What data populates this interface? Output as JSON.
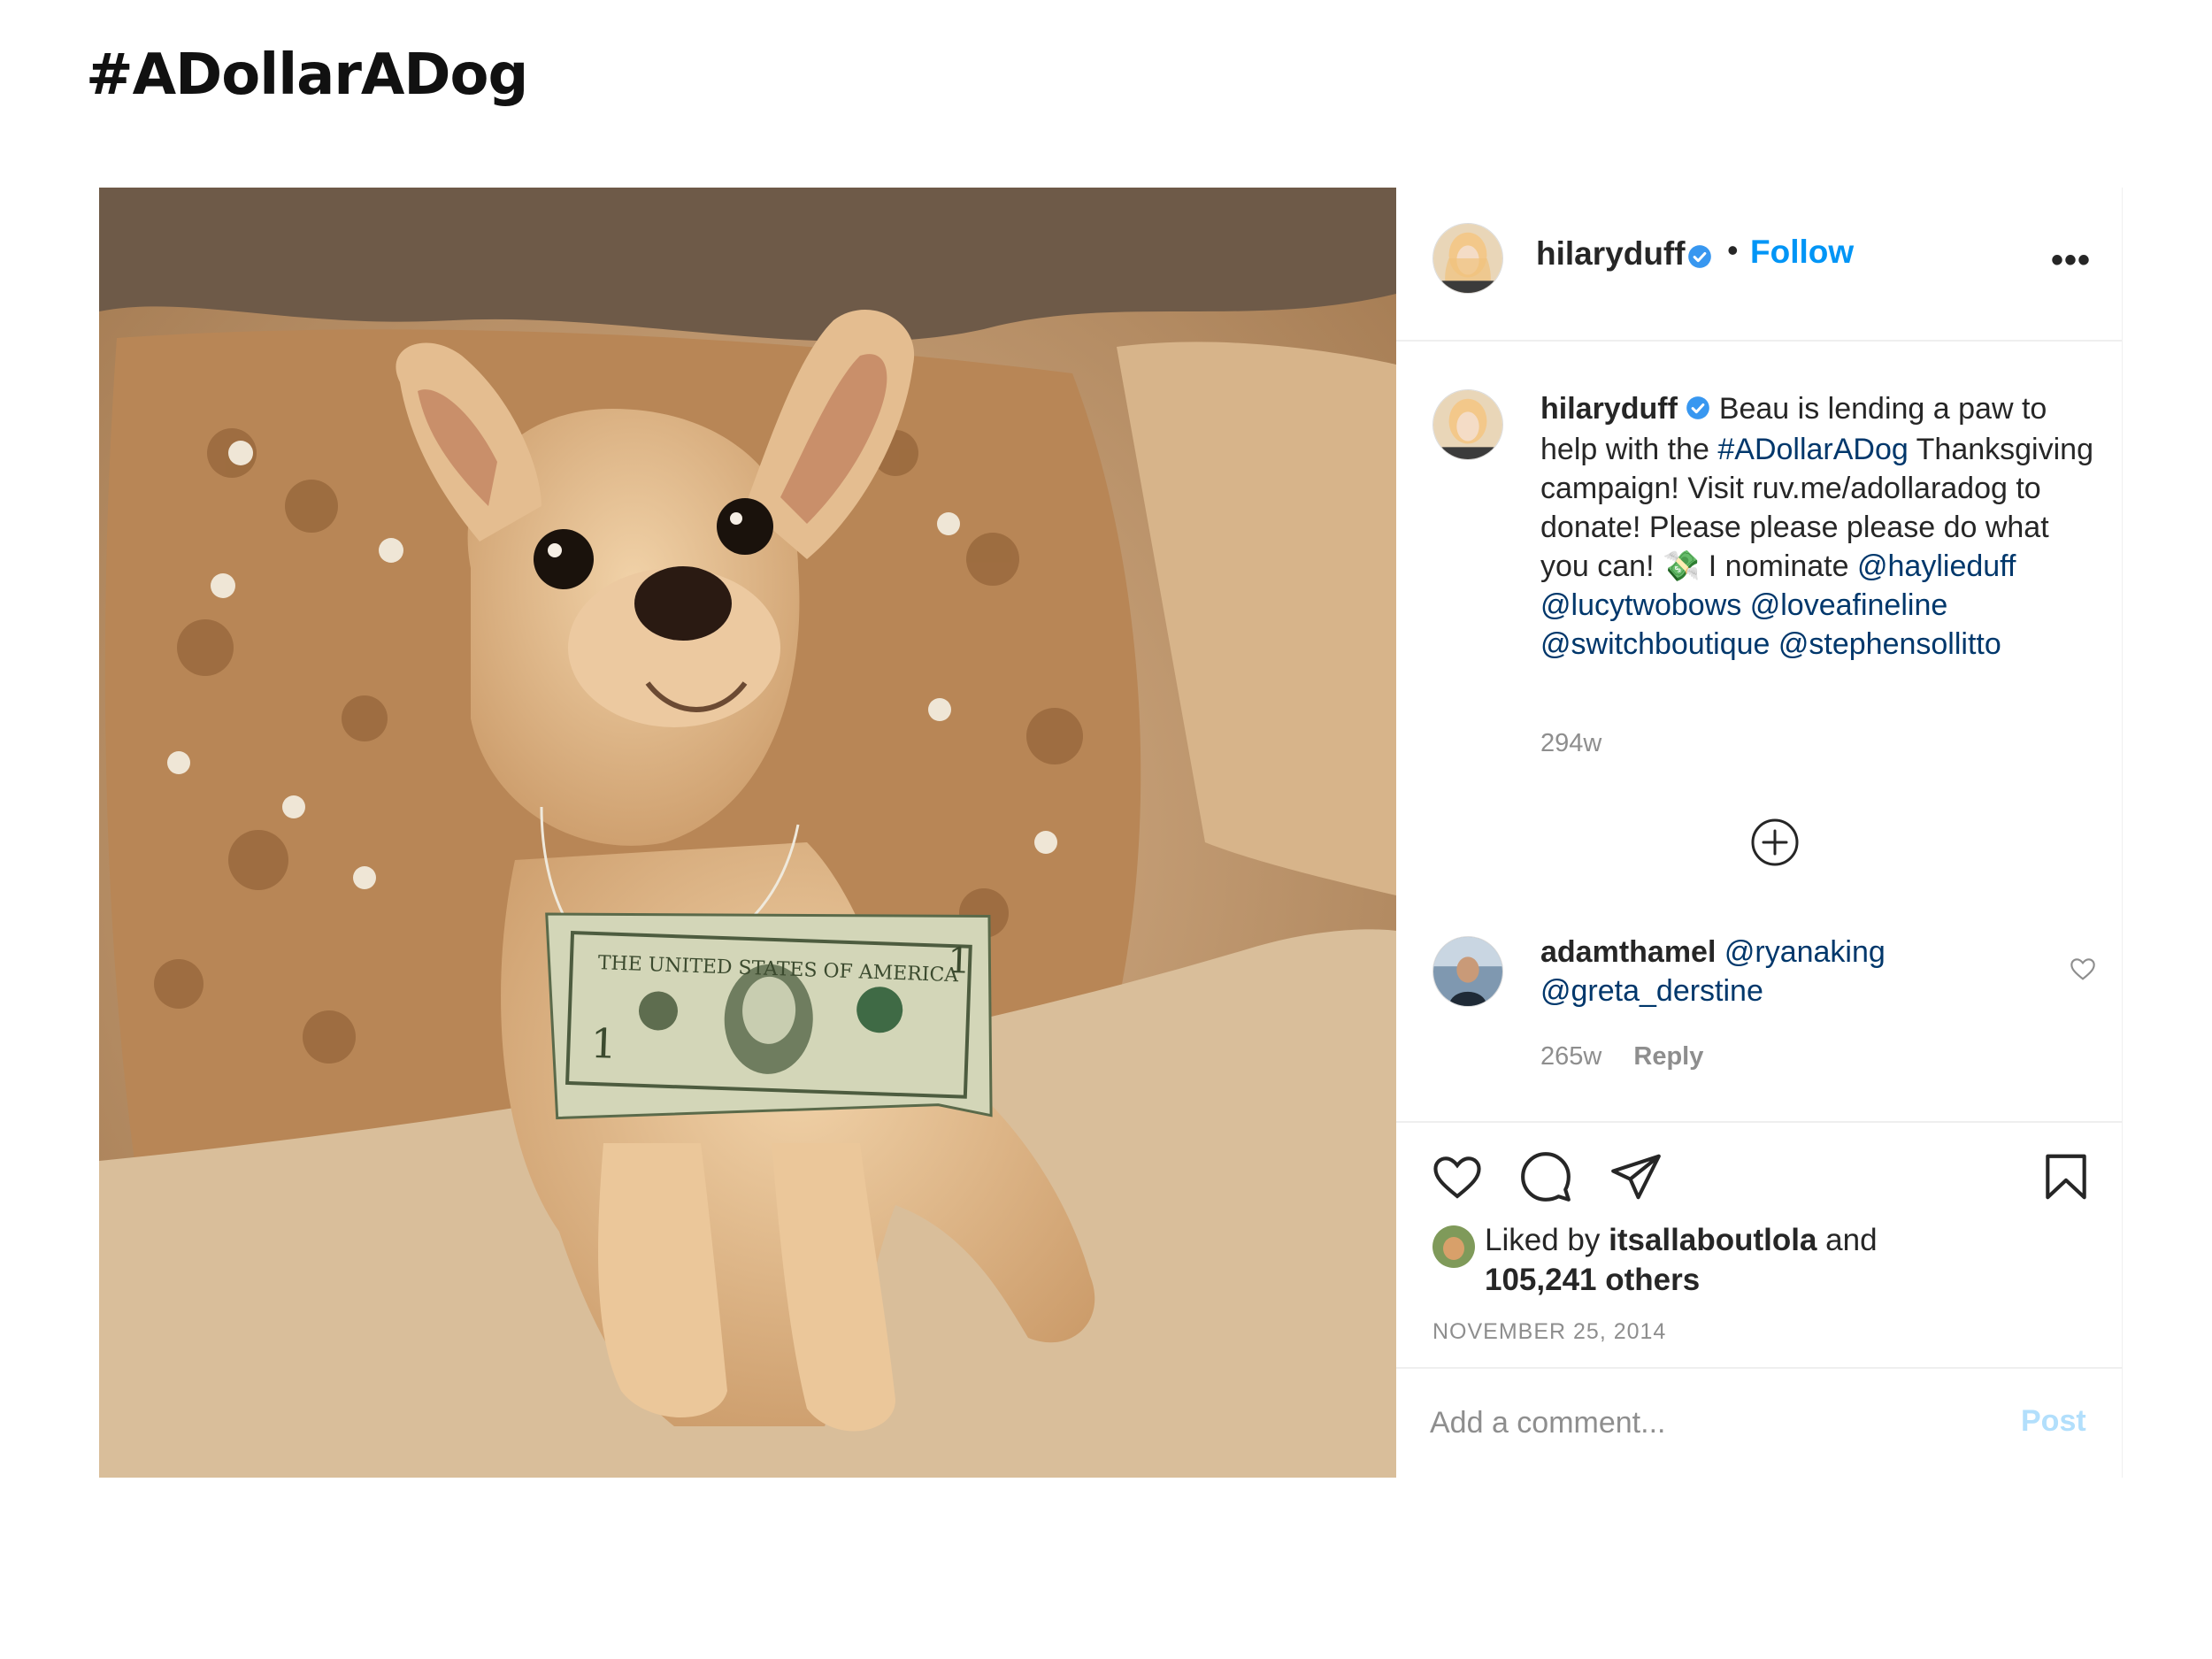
{
  "page": {
    "title": "#ADollarADog"
  },
  "post": {
    "username": "hilaryduff",
    "follow_label": "Follow",
    "separator": "•",
    "more_label": "•••",
    "caption": {
      "username": "hilaryduff",
      "text_1": "Beau is lending a paw to help with the",
      "hashtag": "#ADollarADog",
      "text_2": "Thanksgiving campaign! Visit ruv.me/adollaradog to donate! Please please please do what you can!",
      "emoji": "💸",
      "text_3": "I nominate",
      "mention_1": "@haylieduff",
      "mention_2": "@lucytwobows",
      "mention_3": "@loveafineline",
      "mention_4": "@switchboutique",
      "mention_5": "@stephensollitto",
      "time": "294w"
    },
    "comment": {
      "username": "adamthamel",
      "mention_1": "@ryanaking",
      "mention_2": "@greta_derstine",
      "time": "265w",
      "reply_label": "Reply"
    },
    "likes": {
      "prefix": "Liked by",
      "user": "itsallaboutlola",
      "and": "and",
      "others": "105,241 others"
    },
    "date": "NOVEMBER 25, 2014",
    "add_comment_placeholder": "Add a comment...",
    "post_label": "Post"
  },
  "colors": {
    "link": "#00376b",
    "follow": "#0095f6",
    "post_disabled": "#b2dffc",
    "meta": "#8e8e8e"
  }
}
